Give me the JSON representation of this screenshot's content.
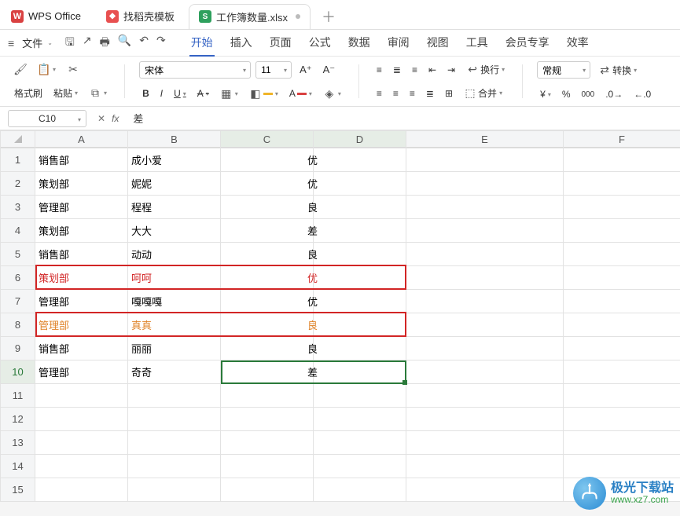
{
  "app": {
    "name": "WPS Office"
  },
  "tabs": [
    {
      "label": "找稻壳模板",
      "icon": "red"
    },
    {
      "label": "工作簿数量.xlsx",
      "icon": "green",
      "active": true
    }
  ],
  "menu": {
    "file_label": "文件",
    "main_tabs": [
      "开始",
      "插入",
      "页面",
      "公式",
      "数据",
      "审阅",
      "视图",
      "工具",
      "会员专享",
      "效率"
    ],
    "active_index": 0
  },
  "ribbon": {
    "format_painter": "格式刷",
    "paste": "粘贴",
    "font_name": "宋体",
    "font_size": "11",
    "wrap": "换行",
    "merge": "合并",
    "number_format": "常规",
    "convert": "转换"
  },
  "formula_bar": {
    "name_box": "C10",
    "fx": "fx",
    "value": "差"
  },
  "columns": [
    "A",
    "B",
    "C",
    "D",
    "E",
    "F"
  ],
  "row_count": 15,
  "active_row": 10,
  "active_cols": [
    "C",
    "D"
  ],
  "rows": [
    {
      "a": "销售部",
      "b": "成小爱",
      "c": "优"
    },
    {
      "a": "策划部",
      "b": "妮妮",
      "c": "优"
    },
    {
      "a": "管理部",
      "b": "程程",
      "c": "良"
    },
    {
      "a": "策划部",
      "b": "大大",
      "c": "差"
    },
    {
      "a": "销售部",
      "b": "动动",
      "c": "良"
    },
    {
      "a": "策划部",
      "b": "呵呵",
      "c": "优",
      "cls": "row-red"
    },
    {
      "a": "管理部",
      "b": "嘎嘎嘎",
      "c": "优"
    },
    {
      "a": "管理部",
      "b": "真真",
      "c": "良",
      "cls": "row-orange"
    },
    {
      "a": "销售部",
      "b": "丽丽",
      "c": "良"
    },
    {
      "a": "管理部",
      "b": "奇奇",
      "c": "差"
    }
  ],
  "watermark": {
    "cn": "极光下载站",
    "url": "www.xz7.com"
  }
}
